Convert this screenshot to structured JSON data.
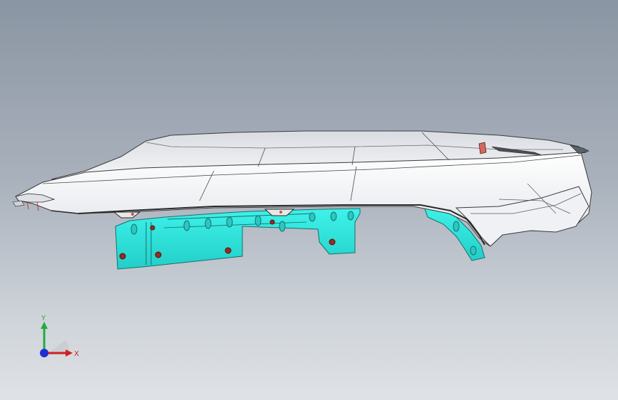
{
  "viewport": {
    "background_top": "#8a95a3",
    "background_bottom": "#dfe2e6"
  },
  "model": {
    "part_body_color": "#f2f2f4",
    "bracket_color": "#33e0d9",
    "bolt_color": "#9b2a1f"
  },
  "triad": {
    "y_label": "Y",
    "x_label": "X",
    "y_color": "#1fae3a",
    "x_color": "#d21f1f",
    "z_color": "#1f2fd2"
  }
}
